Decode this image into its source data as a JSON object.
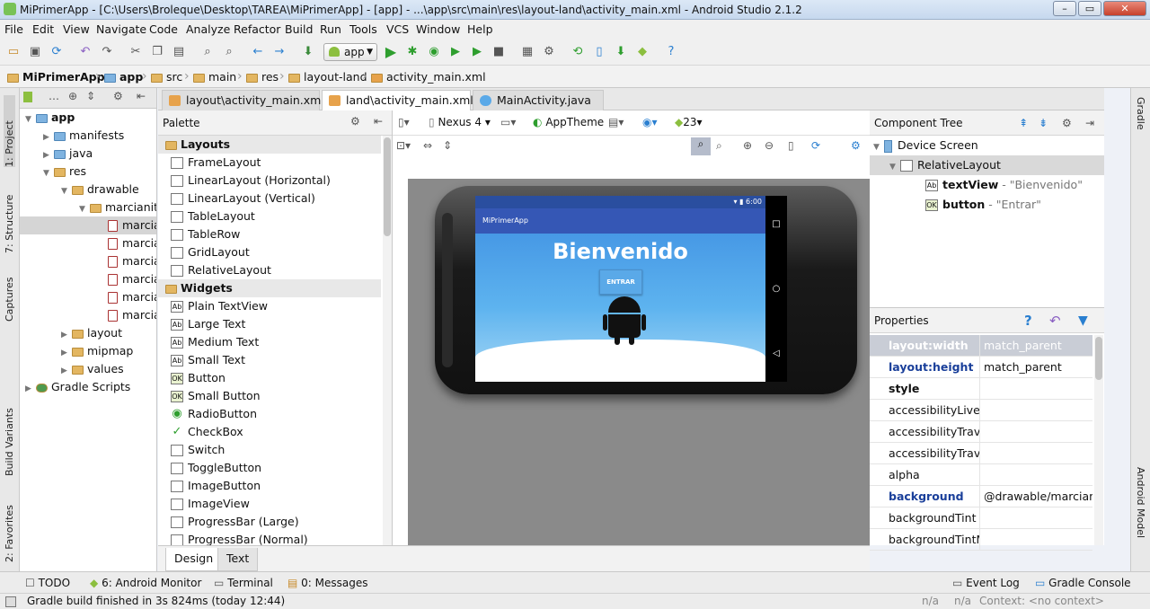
{
  "window": {
    "title": "MiPrimerApp - [C:\\Users\\Broleque\\Desktop\\TAREA\\MiPrimerApp] - [app] - ...\\app\\src\\main\\res\\layout-land\\activity_main.xml - Android Studio 2.1.2",
    "min": "–",
    "max": "▭",
    "close": "✕"
  },
  "menu": [
    "File",
    "Edit",
    "View",
    "Navigate",
    "Code",
    "Analyze",
    "Refactor",
    "Build",
    "Run",
    "Tools",
    "VCS",
    "Window",
    "Help"
  ],
  "toolbar": {
    "run_config": "app"
  },
  "breadcrumb": [
    "MiPrimerApp",
    "app",
    "src",
    "main",
    "res",
    "layout-land",
    "activity_main.xml"
  ],
  "left_tabs": {
    "project": "1: Project",
    "structure": "7: Structure",
    "captures": "Captures",
    "build_variants": "Build Variants",
    "favorites": "2: Favorites"
  },
  "right_tabs": {
    "gradle": "Gradle",
    "android_model": "Android Model"
  },
  "project_tree": [
    {
      "label": "app",
      "indent": 0,
      "type": "module"
    },
    {
      "label": "manifests",
      "indent": 1,
      "type": "folder"
    },
    {
      "label": "java",
      "indent": 1,
      "type": "folder"
    },
    {
      "label": "res",
      "indent": 1,
      "type": "folder"
    },
    {
      "label": "drawable",
      "indent": 2,
      "type": "folder"
    },
    {
      "label": "marcianito",
      "indent": 3,
      "type": "folder"
    },
    {
      "label": "marcia",
      "indent": 4,
      "type": "file",
      "selected": true
    },
    {
      "label": "marcia",
      "indent": 4,
      "type": "file"
    },
    {
      "label": "marcia",
      "indent": 4,
      "type": "file"
    },
    {
      "label": "marcia",
      "indent": 4,
      "type": "file"
    },
    {
      "label": "marcia",
      "indent": 4,
      "type": "file"
    },
    {
      "label": "marcia",
      "indent": 4,
      "type": "file"
    },
    {
      "label": "layout",
      "indent": 2,
      "type": "folder"
    },
    {
      "label": "mipmap",
      "indent": 2,
      "type": "folder"
    },
    {
      "label": "values",
      "indent": 2,
      "type": "folder"
    },
    {
      "label": "Gradle Scripts",
      "indent": 0,
      "type": "gradle"
    }
  ],
  "editor_tabs": [
    {
      "label": "layout\\activity_main.xml",
      "active": false
    },
    {
      "label": "land\\activity_main.xml",
      "active": true
    },
    {
      "label": "MainActivity.java",
      "active": false
    }
  ],
  "palette": {
    "title": "Palette",
    "rows": [
      {
        "label": "Layouts",
        "group": true
      },
      {
        "label": "FrameLayout",
        "icon": ""
      },
      {
        "label": "LinearLayout (Horizontal)",
        "icon": ""
      },
      {
        "label": "LinearLayout (Vertical)",
        "icon": ""
      },
      {
        "label": "TableLayout",
        "icon": ""
      },
      {
        "label": "TableRow",
        "icon": ""
      },
      {
        "label": "GridLayout",
        "icon": ""
      },
      {
        "label": "RelativeLayout",
        "icon": ""
      },
      {
        "label": "Widgets",
        "group": true
      },
      {
        "label": "Plain TextView",
        "icon": "Ab"
      },
      {
        "label": "Large Text",
        "icon": "Ab"
      },
      {
        "label": "Medium Text",
        "icon": "Ab"
      },
      {
        "label": "Small Text",
        "icon": "Ab"
      },
      {
        "label": "Button",
        "icon": "OK"
      },
      {
        "label": "Small Button",
        "icon": "OK"
      },
      {
        "label": "RadioButton",
        "icon": "◉"
      },
      {
        "label": "CheckBox",
        "icon": "✓"
      },
      {
        "label": "Switch",
        "icon": ""
      },
      {
        "label": "ToggleButton",
        "icon": ""
      },
      {
        "label": "ImageButton",
        "icon": ""
      },
      {
        "label": "ImageView",
        "icon": ""
      },
      {
        "label": "ProgressBar (Large)",
        "icon": ""
      },
      {
        "label": "ProgressBar (Normal)",
        "icon": ""
      }
    ]
  },
  "design_toolbar": {
    "device": "Nexus 4",
    "theme": "AppTheme",
    "api": "23"
  },
  "preview": {
    "status_time": "6:00",
    "app_title": "MiPrimerApp",
    "heading": "Bienvenido",
    "button": "ENTRAR"
  },
  "component_tree": {
    "title": "Component Tree",
    "device": "Device Screen",
    "root": "RelativeLayout",
    "children": [
      {
        "name": "textView",
        "value": "- \"Bienvenido\"",
        "icon": "Ab"
      },
      {
        "name": "button",
        "value": "- \"Entrar\"",
        "icon": "OK"
      }
    ]
  },
  "properties": {
    "title": "Properties",
    "rows": [
      {
        "name": "layout:width",
        "value": "match_parent",
        "state": "highlight"
      },
      {
        "name": "layout:height",
        "value": "match_parent",
        "state": "set"
      },
      {
        "name": "style",
        "value": "",
        "state": "bold"
      },
      {
        "name": "accessibilityLiveRegion",
        "value": "",
        "state": "normal"
      },
      {
        "name": "accessibilityTraversalAfter",
        "value": "",
        "state": "normal"
      },
      {
        "name": "accessibilityTraversalBefore",
        "value": "",
        "state": "normal"
      },
      {
        "name": "alpha",
        "value": "",
        "state": "normal"
      },
      {
        "name": "background",
        "value": "@drawable/marcianito",
        "state": "set"
      },
      {
        "name": "backgroundTint",
        "value": "",
        "state": "normal"
      },
      {
        "name": "backgroundTintMode",
        "value": "",
        "state": "normal"
      }
    ]
  },
  "design_tabs": [
    "Design",
    "Text"
  ],
  "tool_windows": {
    "todo": "TODO",
    "monitor": "6: Android Monitor",
    "terminal": "Terminal",
    "messages": "0: Messages",
    "event_log": "Event Log",
    "gradle_console": "Gradle Console"
  },
  "status": {
    "message": "Gradle build finished in 3s 824ms (today 12:44)",
    "na1": "n/a",
    "na2": "n/a",
    "context": "Context: <no context>"
  }
}
